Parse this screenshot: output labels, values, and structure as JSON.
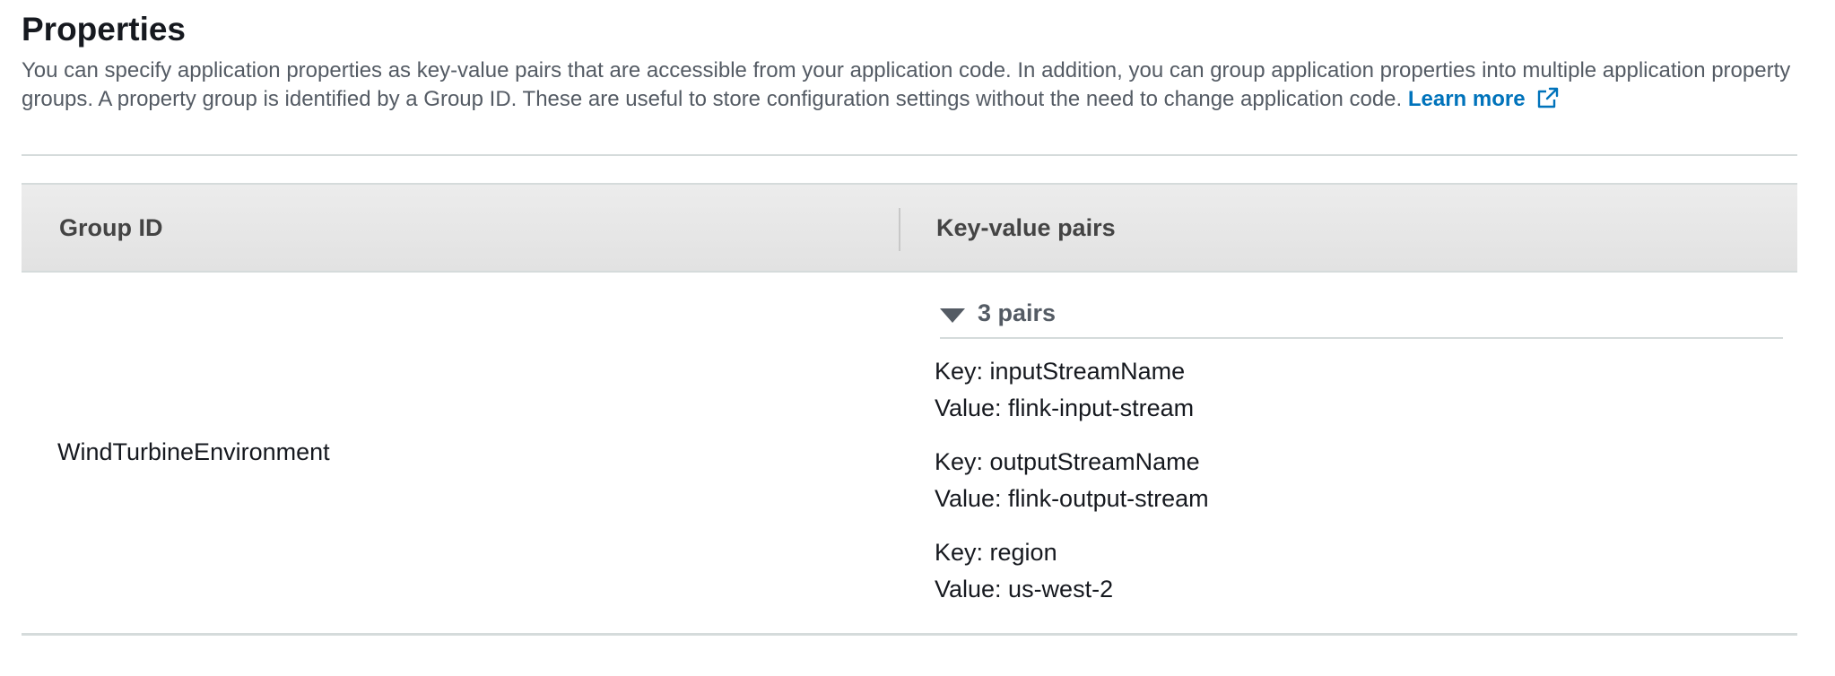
{
  "section": {
    "title": "Properties",
    "description": "You can specify application properties as key-value pairs that are accessible from your application code. In addition, you can group application properties into multiple application property groups. A property group is identified by a Group ID. These are useful to store configuration settings without the need to change application code.",
    "learn_more": "Learn more",
    "learn_more_icon": "external-link-icon",
    "link_color": "#0073bb"
  },
  "table": {
    "columns": {
      "group_id": "Group ID",
      "key_value_pairs": "Key-value pairs"
    },
    "rows": [
      {
        "group_id": "WindTurbineEnvironment",
        "pairs_toggle": "3 pairs",
        "pairs": [
          {
            "key": "Key: inputStreamName",
            "value": "Value: flink-input-stream"
          },
          {
            "key": "Key: outputStreamName",
            "value": "Value: flink-output-stream"
          },
          {
            "key": "Key: region",
            "value": "Value: us-west-2"
          }
        ]
      }
    ]
  }
}
